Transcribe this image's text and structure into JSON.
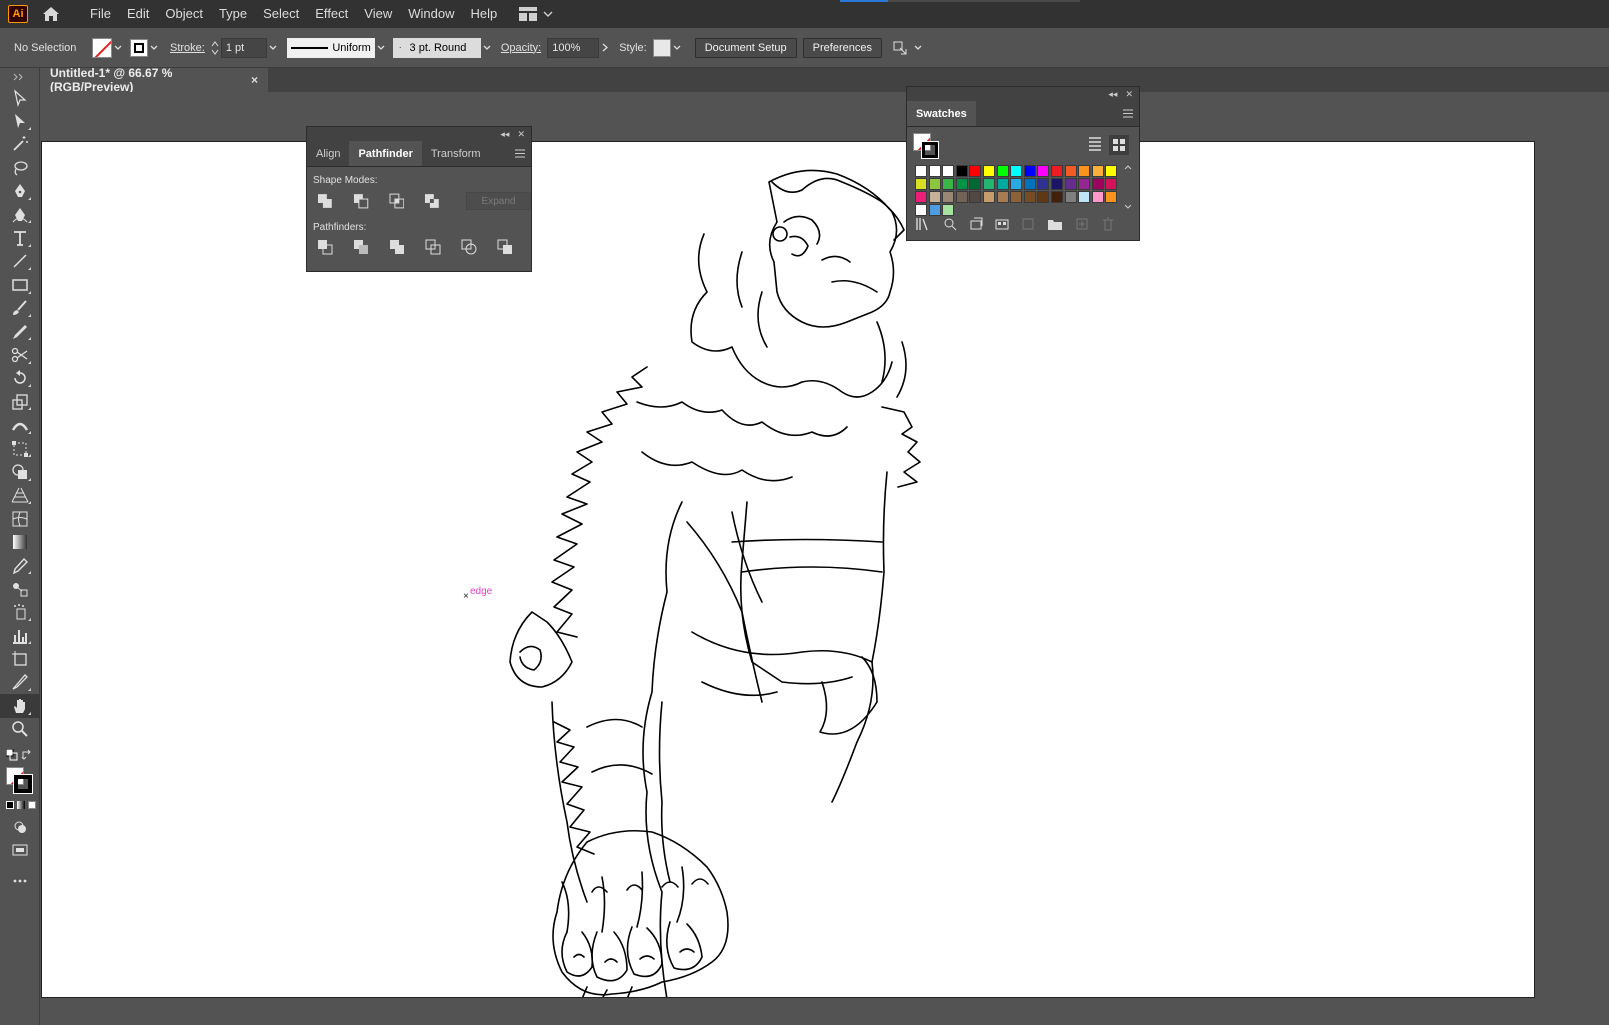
{
  "app": {
    "logo": "Ai"
  },
  "menu": [
    "File",
    "Edit",
    "Object",
    "Type",
    "Select",
    "Effect",
    "View",
    "Window",
    "Help"
  ],
  "control_bar": {
    "selection_label": "No Selection",
    "stroke_label": "Stroke:",
    "stroke_weight": "1 pt",
    "profile": "Uniform",
    "brush": "3 pt. Round",
    "opacity_label": "Opacity:",
    "opacity_value": "100%",
    "style_label": "Style:",
    "document_setup": "Document Setup",
    "preferences": "Preferences"
  },
  "document": {
    "tab_title": "Untitled-1* @ 66.67 % (RGB/Preview)",
    "close": "×"
  },
  "smart_guide": {
    "label": "edge",
    "marker": "×"
  },
  "pathfinder_panel": {
    "tabs": [
      "Align",
      "Pathfinder",
      "Transform"
    ],
    "active_tab": "Pathfinder",
    "shape_modes_label": "Shape Modes:",
    "expand_label": "Expand",
    "pathfinders_label": "Pathfinders:"
  },
  "swatches_panel": {
    "tab": "Swatches",
    "colors": [
      "#ffffff",
      "#000000",
      "#ff0000",
      "#ffff00",
      "#00ff00",
      "#00ffff",
      "#0000ff",
      "#ff00ff",
      "#ed1c24",
      "#f15a24",
      "#f7931e",
      "#fbb03b",
      "#ffff00",
      "#d9e021",
      "#8cc63f",
      "#39b54a",
      "#009245",
      "#006837",
      "#22b573",
      "#00a99d",
      "#29abe2",
      "#0071bc",
      "#2e3192",
      "#1b1464",
      "#662d91",
      "#93278f",
      "#9e005d",
      "#d4145a",
      "#ed1e79",
      "#c7b299",
      "#998675",
      "#736357",
      "#534741",
      "#c69c6d",
      "#a67c52",
      "#8c6239",
      "#754c24",
      "#603813",
      "#42210b",
      "#808080",
      "#c0e4f7",
      "#ff99cc",
      "#f7931e",
      "#ffffff",
      "#4d9de0",
      "#a6e3a1"
    ]
  },
  "colors": {
    "accent": "#2b78d4",
    "chrome": "#535353",
    "menubar": "#323232",
    "smart_guide": "#e040c8"
  }
}
